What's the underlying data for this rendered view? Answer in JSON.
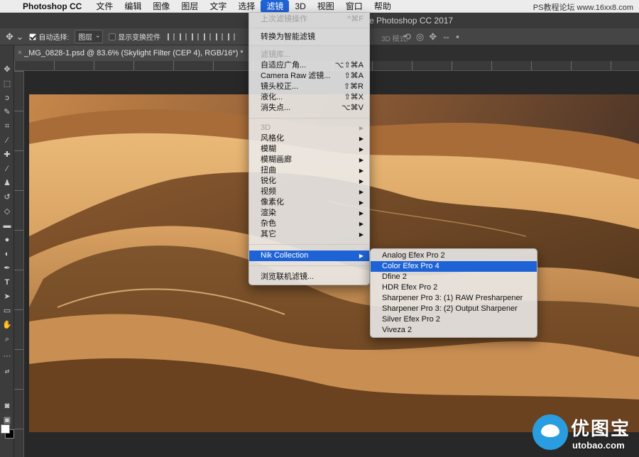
{
  "menubar": {
    "app_name": "Photoshop CC",
    "items": [
      "文件",
      "编辑",
      "图像",
      "图层",
      "文字",
      "选择",
      "滤镜",
      "3D",
      "视图",
      "窗口",
      "帮助"
    ],
    "active_index": 6,
    "watermark": "PS教程论坛 www.16xx8.com"
  },
  "titlebar": {
    "title": "e Photoshop CC 2017"
  },
  "options_bar": {
    "auto_select_label": "自动选择:",
    "auto_select_value": "图层",
    "show_transform_label": "显示变换控件",
    "mode_3d_label": "3D 模式:"
  },
  "document_tab": {
    "title": "_MG_0828-1.psd @ 83.6% (Skylight Filter (CEP 4), RGB/16*) *",
    "close_glyph": "×"
  },
  "filter_menu": {
    "items": [
      {
        "label": "上次滤镜操作",
        "shortcut": "^⌘F",
        "disabled": true
      },
      {
        "label": "转换为智能滤镜"
      },
      {
        "label": "滤镜库...",
        "disabled": true
      },
      {
        "label": "自适应广角...",
        "shortcut": "⌥⇧⌘A"
      },
      {
        "label": "Camera Raw 滤镜...",
        "shortcut": "⇧⌘A"
      },
      {
        "label": "镜头校正...",
        "shortcut": "⇧⌘R"
      },
      {
        "label": "液化...",
        "shortcut": "⇧⌘X"
      },
      {
        "label": "消失点...",
        "shortcut": "⌥⌘V"
      },
      {
        "label": "3D",
        "submenu": true,
        "disabled": true
      },
      {
        "label": "风格化",
        "submenu": true
      },
      {
        "label": "模糊",
        "submenu": true
      },
      {
        "label": "模糊画廊",
        "submenu": true
      },
      {
        "label": "扭曲",
        "submenu": true
      },
      {
        "label": "锐化",
        "submenu": true
      },
      {
        "label": "视频",
        "submenu": true
      },
      {
        "label": "像素化",
        "submenu": true
      },
      {
        "label": "渲染",
        "submenu": true
      },
      {
        "label": "杂色",
        "submenu": true
      },
      {
        "label": "其它",
        "submenu": true
      },
      {
        "label": "Nik Collection",
        "submenu": true,
        "highlighted": true
      },
      {
        "label": "浏览联机滤镜..."
      }
    ]
  },
  "nik_menu": {
    "items": [
      {
        "label": "Analog Efex Pro 2"
      },
      {
        "label": "Color Efex Pro 4",
        "highlighted": true
      },
      {
        "label": "Dfine 2"
      },
      {
        "label": "HDR Efex Pro 2"
      },
      {
        "label": "Sharpener Pro 3: (1) RAW Presharpener"
      },
      {
        "label": "Sharpener Pro 3: (2) Output Sharpener"
      },
      {
        "label": "Silver Efex Pro 2"
      },
      {
        "label": "Viveza 2"
      }
    ]
  },
  "logo": {
    "text_cn": "优图宝",
    "text_en": "utobao.com"
  },
  "colors": {
    "accent": "#1e63d6",
    "menu_bg": "#ececec",
    "panel": "#3c3c3c",
    "sand_light": "#e0a866",
    "sand_dark": "#3a2412"
  }
}
